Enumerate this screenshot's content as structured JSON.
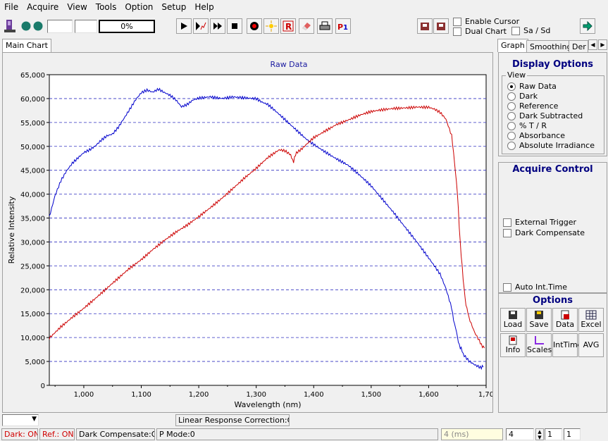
{
  "menu": [
    "File",
    "Acquire",
    "View",
    "Tools",
    "Option",
    "Setup",
    "Help"
  ],
  "toolbar": {
    "progress_text": "0%",
    "enable_cursor_label": "Enable Cursor",
    "dual_chart_label": "Dual Chart",
    "sa_sd_label": "Sa / Sd"
  },
  "tabs": {
    "main_chart": "Main Chart"
  },
  "right_tabs": [
    "Graph",
    "Smoothing",
    "Der"
  ],
  "display_options": {
    "title": "Display Options",
    "view_label": "View",
    "items": [
      "Raw Data",
      "Dark",
      "Reference",
      "Dark Subtracted",
      "% T / R",
      "Absorbance",
      "Absolute Irradiance"
    ],
    "selected_index": 0
  },
  "acquire_control": {
    "title": "Acquire Control",
    "external_trigger": "External Trigger",
    "dark_compensate": "Dark Compensate",
    "auto_int_time": "Auto Int.Time"
  },
  "options": {
    "title": "Options",
    "buttons": [
      "Load",
      "Save",
      "Data",
      "Excel",
      "Info",
      "Scales",
      "IntTime",
      "AVG"
    ]
  },
  "status": {
    "dark": "Dark: ON",
    "ref": "Ref.: ON",
    "dark_comp": "Dark Compensate:OFF",
    "pmode": "P Mode:0",
    "int_time": "4 (ms)",
    "avg": "4",
    "v1": "1",
    "v2": "1",
    "linear": "Linear Response Correction:OFF"
  },
  "chart_data": {
    "type": "line",
    "title": "Raw Data",
    "xlabel": "Wavelength (nm)",
    "ylabel": "Relative Intensity",
    "xlim": [
      940,
      1700
    ],
    "ylim": [
      0,
      65000
    ],
    "x_ticks": [
      "1,000",
      "1,100",
      "1,200",
      "1,300",
      "1,400",
      "1,500",
      "1,600",
      "1,70"
    ],
    "y_ticks": [
      "0",
      "5,000",
      "10,000",
      "15,000",
      "20,000",
      "25,000",
      "30,000",
      "35,000",
      "40,000",
      "45,000",
      "50,000",
      "55,000",
      "60,000",
      "65,000"
    ],
    "grid": true,
    "series": [
      {
        "color": "#0000cc",
        "x": [
          940,
          950,
          960,
          970,
          980,
          990,
          1000,
          1010,
          1020,
          1030,
          1040,
          1050,
          1060,
          1070,
          1080,
          1090,
          1100,
          1110,
          1120,
          1130,
          1140,
          1150,
          1160,
          1170,
          1180,
          1190,
          1200,
          1220,
          1240,
          1260,
          1280,
          1300,
          1310,
          1320,
          1330,
          1340,
          1350,
          1360,
          1370,
          1380,
          1390,
          1400,
          1420,
          1440,
          1460,
          1480,
          1500,
          1520,
          1540,
          1560,
          1580,
          1600,
          1620,
          1630,
          1640,
          1645,
          1650,
          1655,
          1660,
          1670,
          1680,
          1690,
          1695
        ],
        "y": [
          35500,
          40000,
          43000,
          45000,
          46500,
          47500,
          48500,
          49000,
          49800,
          51000,
          52000,
          52500,
          54000,
          56000,
          58000,
          60000,
          61500,
          62000,
          61500,
          62000,
          61200,
          60500,
          59500,
          58000,
          58500,
          59500,
          60000,
          60500,
          60300,
          60600,
          60200,
          59800,
          59000,
          58500,
          57500,
          56500,
          55500,
          54500,
          53500,
          52500,
          51500,
          50700,
          49000,
          47300,
          45800,
          43700,
          41600,
          39000,
          36300,
          33200,
          30000,
          26500,
          23000,
          20000,
          16000,
          13000,
          10000,
          8000,
          6500,
          5200,
          4500,
          4000,
          3800
        ]
      },
      {
        "color": "#cc0000",
        "x": [
          940,
          960,
          980,
          1000,
          1020,
          1040,
          1060,
          1080,
          1100,
          1120,
          1140,
          1160,
          1180,
          1200,
          1220,
          1240,
          1260,
          1280,
          1300,
          1320,
          1340,
          1350,
          1360,
          1365,
          1370,
          1380,
          1390,
          1400,
          1420,
          1440,
          1460,
          1480,
          1500,
          1520,
          1540,
          1560,
          1580,
          1600,
          1610,
          1620,
          1630,
          1640,
          1645,
          1650,
          1655,
          1660,
          1665,
          1670,
          1680,
          1690,
          1697
        ],
        "y": [
          10000,
          12500,
          14500,
          16200,
          18000,
          20000,
          22200,
          24500,
          26500,
          28700,
          30500,
          32000,
          33300,
          35000,
          37000,
          39200,
          41500,
          43700,
          45500,
          47500,
          49000,
          48800,
          48000,
          47000,
          48500,
          49500,
          50800,
          52000,
          53500,
          54800,
          55500,
          56300,
          57000,
          57500,
          58000,
          58300,
          58500,
          58300,
          57800,
          57000,
          55500,
          52000,
          47000,
          40000,
          30000,
          22000,
          17000,
          14000,
          11000,
          9000,
          7800
        ]
      }
    ]
  }
}
